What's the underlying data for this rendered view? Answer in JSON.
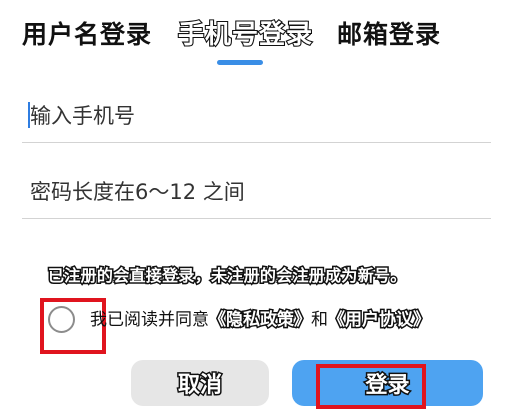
{
  "tabs": {
    "username_login": "用户名登录",
    "phone_login": "手机号登录",
    "email_login": "邮箱登录",
    "active": "phone_login"
  },
  "form": {
    "phone_placeholder": "输入手机号",
    "password_placeholder": "密码长度在6～12 之间"
  },
  "notice": {
    "text": "已注册的会直接登录，未注册的会注册成为新号。"
  },
  "agreement": {
    "prefix": "我已阅读并同意",
    "privacy_policy": "《隐私政策》",
    "conjunction": "和",
    "user_agreement": "《用户协议》",
    "checked": false
  },
  "buttons": {
    "cancel": "取消",
    "login": "登录"
  },
  "colors": {
    "accent": "#3a8ee6",
    "login_button": "#4ea3f1",
    "cancel_button": "#e6e6e6",
    "highlight": "#e0141e"
  }
}
